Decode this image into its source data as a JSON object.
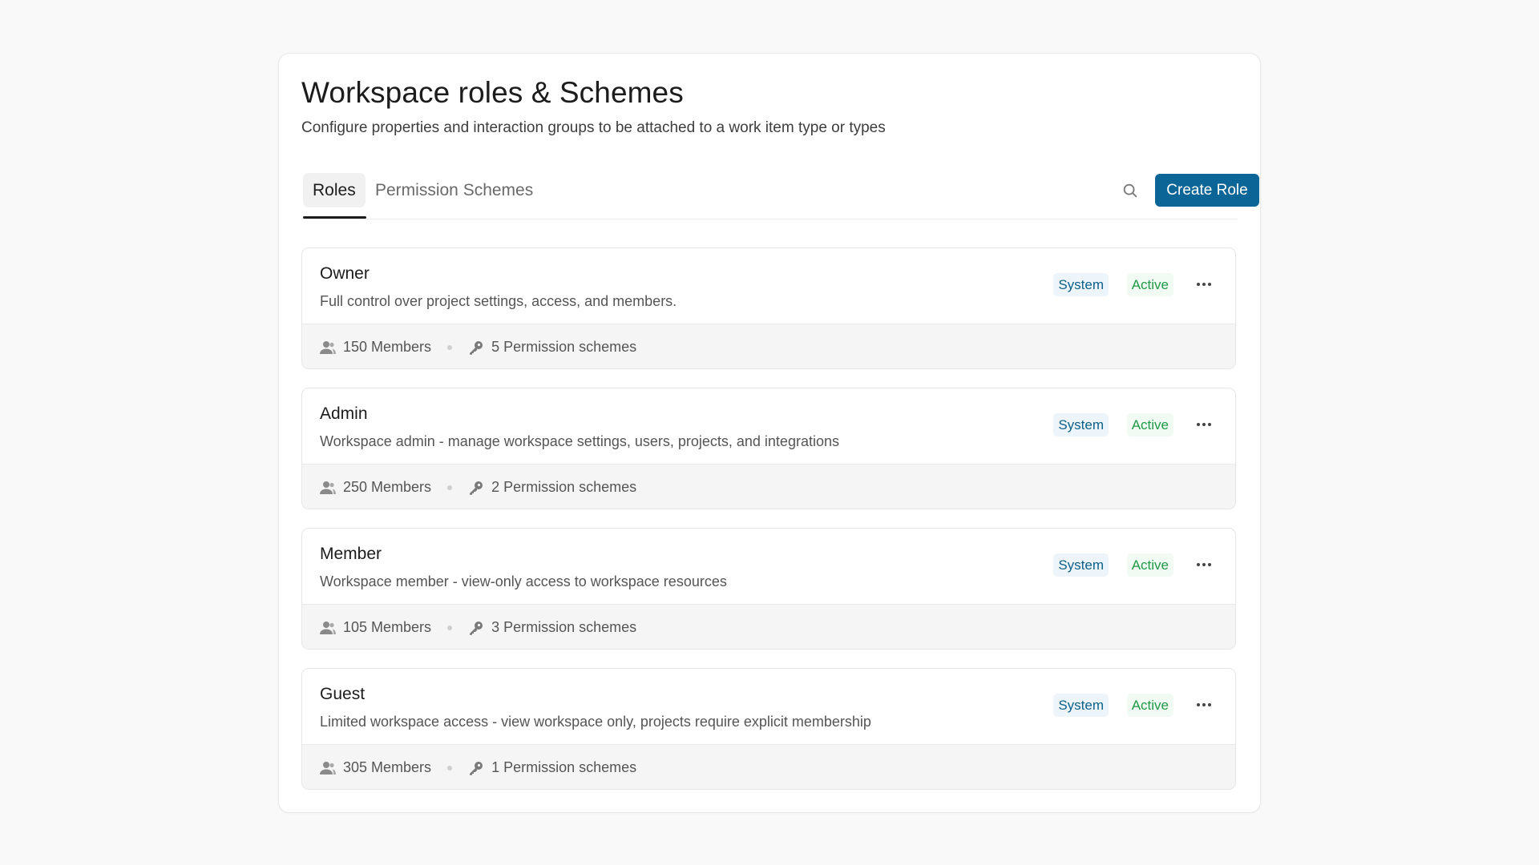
{
  "header": {
    "title": "Workspace roles & Schemes",
    "subtitle": "Configure properties and interaction groups to be attached to a work item type or types"
  },
  "tabs": [
    {
      "label": "Roles",
      "active": true
    },
    {
      "label": "Permission Schemes",
      "active": false
    }
  ],
  "toolbar": {
    "search_icon": "search-icon",
    "create_label": "Create Role"
  },
  "colors": {
    "primary": "#0b6596",
    "system_badge_text": "#0b5f8a",
    "active_badge_text": "#1e9a46"
  },
  "roles": [
    {
      "name": "Owner",
      "description": "Full control over project settings, access, and members.",
      "system_label": "System",
      "status": "Active",
      "members": "150 Members",
      "schemes": "5 Permission schemes"
    },
    {
      "name": "Admin",
      "description": "Workspace admin - manage workspace settings, users, projects, and integrations",
      "system_label": "System",
      "status": "Active",
      "members": "250 Members",
      "schemes": "2 Permission schemes"
    },
    {
      "name": "Member",
      "description": "Workspace member - view-only access to workspace resources",
      "system_label": "System",
      "status": "Active",
      "members": "105 Members",
      "schemes": "3 Permission schemes"
    },
    {
      "name": "Guest",
      "description": "Limited workspace access - view workspace only, projects require explicit membership",
      "system_label": "System",
      "status": "Active",
      "members": "305 Members",
      "schemes": "1 Permission schemes"
    }
  ]
}
